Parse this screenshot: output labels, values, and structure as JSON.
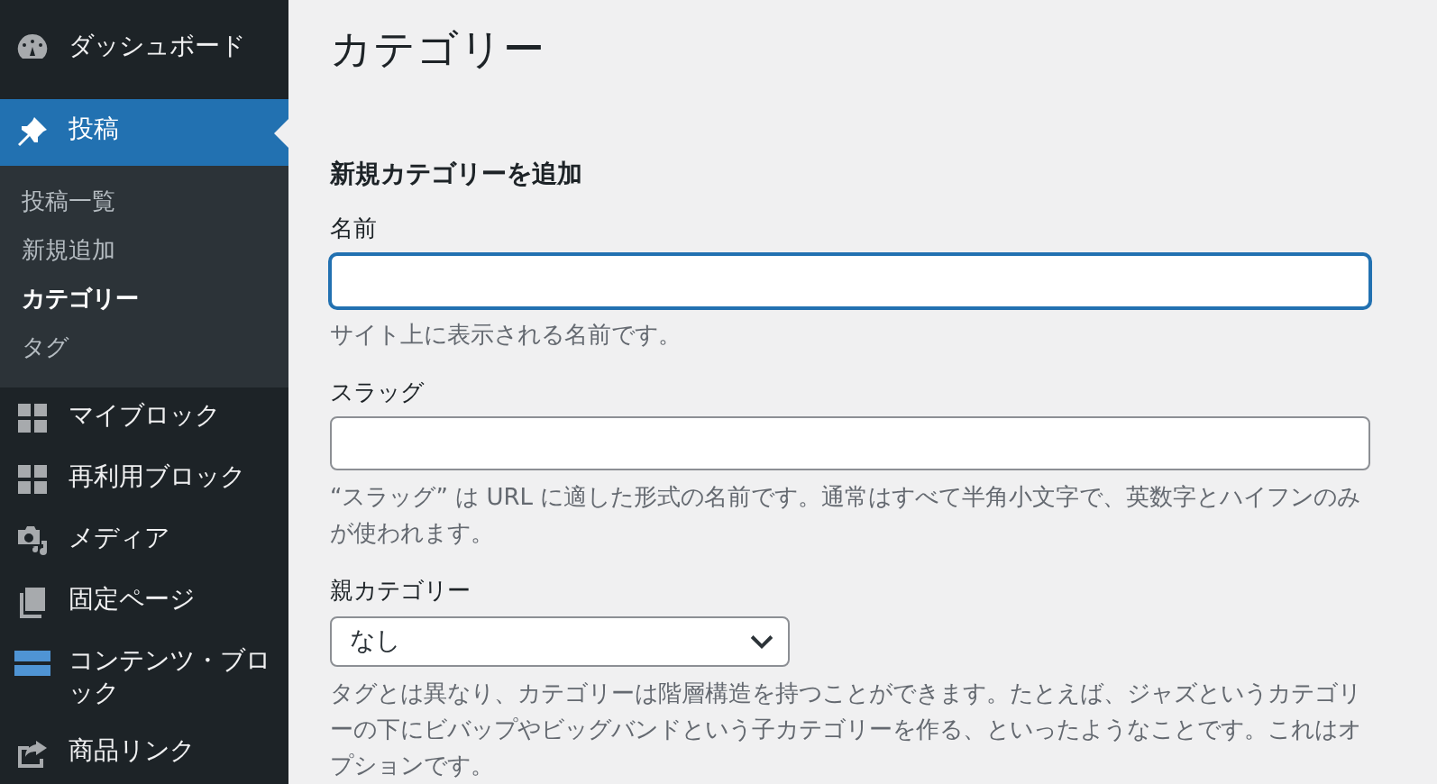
{
  "sidebar": {
    "items": [
      {
        "label": "ダッシュボード",
        "selected": false
      },
      {
        "label": "投稿",
        "selected": true,
        "children": [
          {
            "label": "投稿一覧",
            "selected": false
          },
          {
            "label": "新規追加",
            "selected": false
          },
          {
            "label": "カテゴリー",
            "selected": true
          },
          {
            "label": "タグ",
            "selected": false
          }
        ]
      },
      {
        "label": "マイブロック",
        "selected": false
      },
      {
        "label": "再利用ブロック",
        "selected": false
      },
      {
        "label": "メディア",
        "selected": false
      },
      {
        "label": "固定ページ",
        "selected": false
      },
      {
        "label": "コンテンツ・ブロック",
        "selected": false
      },
      {
        "label": "商品リンク",
        "selected": false
      }
    ]
  },
  "page": {
    "title": "カテゴリー",
    "section_title": "新規カテゴリーを追加",
    "fields": [
      {
        "kind": "text",
        "label": "名前",
        "focused": true,
        "help": "サイト上に表示される名前です。"
      },
      {
        "kind": "text",
        "label": "スラッグ",
        "focused": false,
        "help": "“スラッグ” は URL に適した形式の名前です。通常はすべて半角小文字で、英数字とハイフンのみが使われます。"
      },
      {
        "kind": "select",
        "label": "親カテゴリー",
        "value": "なし",
        "help": "タグとは異なり、カテゴリーは階層構造を持つことができます。たとえば、ジャズというカテゴリーの下にビバップやビッグバンドという子カテゴリーを作る、といったようなことです。これはオプションです。"
      }
    ]
  }
}
